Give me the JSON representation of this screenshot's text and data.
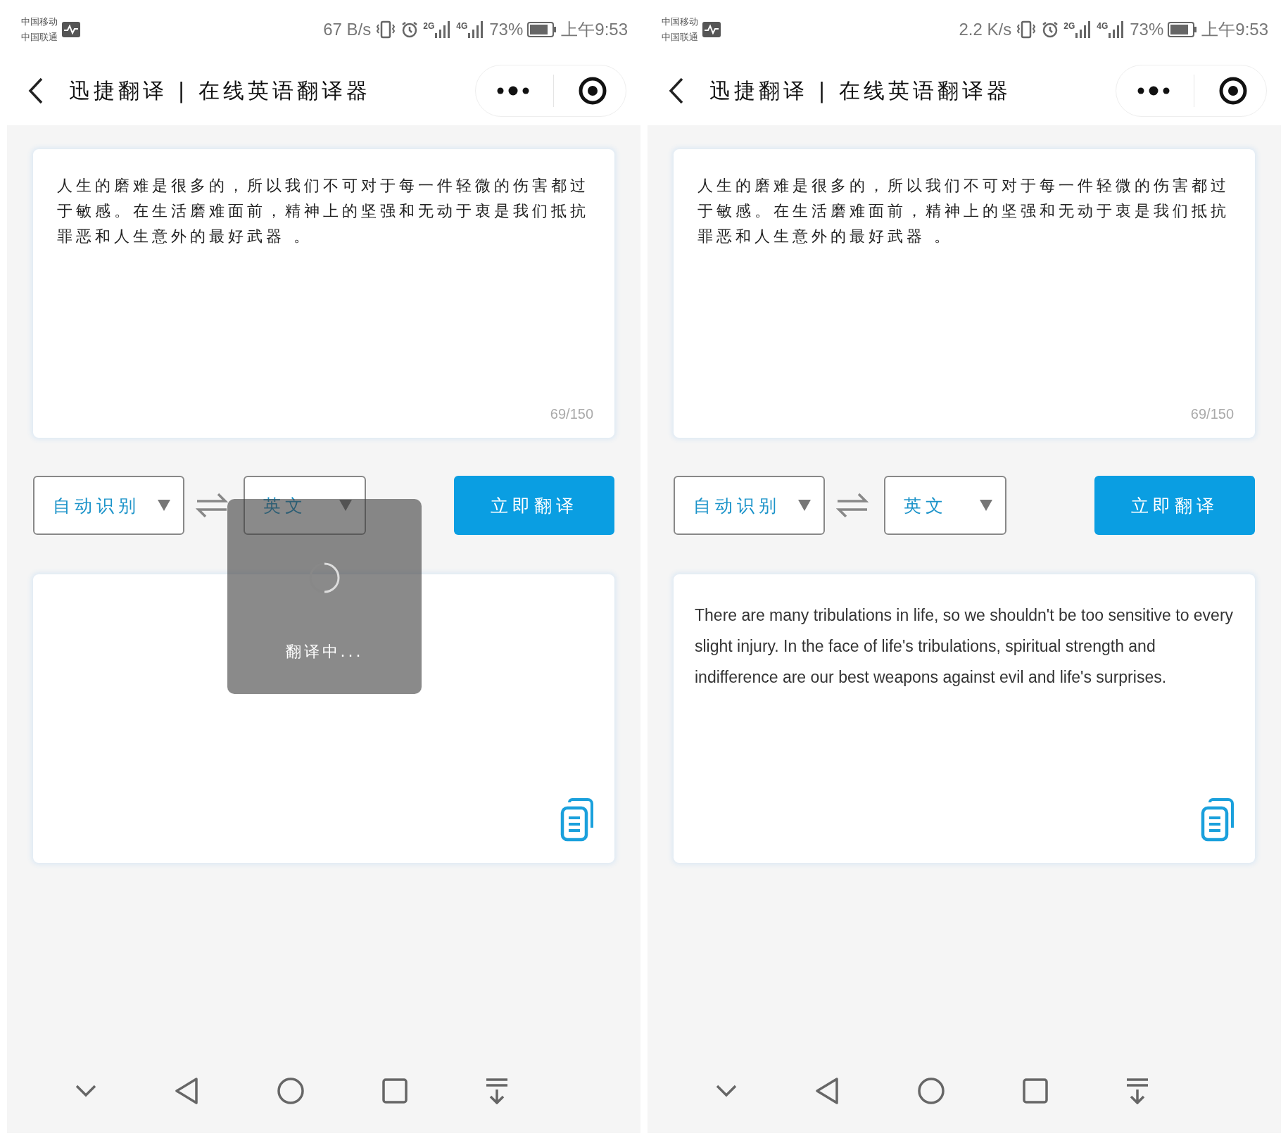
{
  "phones": [
    {
      "status": {
        "carrier_1": "中国移动",
        "carrier_2": "中国联通",
        "speed": "67 B/s",
        "net_1": "2G",
        "net_2": "4G",
        "battery": "73%",
        "time": "上午9:53"
      },
      "title": "迅捷翻译 | 在线英语翻译器",
      "source_text": "人生的磨难是很多的，所以我们不可对于每一件轻微的伤害都过于敏感。在生活磨难面前，精神上的坚强和无动于衷是我们抵抗罪恶和人生意外的最好武器 。",
      "counter": "69/150",
      "source_lang": "自动识别",
      "target_lang": "英文",
      "translate_button": "立即翻译",
      "loading": {
        "text": "翻译中..."
      }
    },
    {
      "status": {
        "carrier_1": "中国移动",
        "carrier_2": "中国联通",
        "speed": "2.2 K/s",
        "net_1": "2G",
        "net_2": "4G",
        "battery": "73%",
        "time": "上午9:53"
      },
      "title": "迅捷翻译 | 在线英语翻译器",
      "source_text": "人生的磨难是很多的，所以我们不可对于每一件轻微的伤害都过于敏感。在生活磨难面前，精神上的坚强和无动于衷是我们抵抗罪恶和人生意外的最好武器 。",
      "counter": "69/150",
      "source_lang": "自动识别",
      "target_lang": "英文",
      "translate_button": "立即翻译",
      "result": "There are many tribulations in life, so we shouldn't be too sensitive to every slight injury. In the face of life's tribulations, spiritual strength and indifference are our best weapons against evil and life's surprises."
    }
  ]
}
